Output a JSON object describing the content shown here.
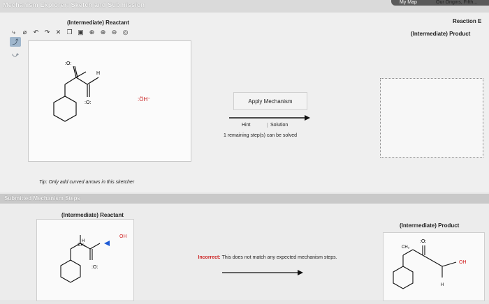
{
  "header": {
    "title": "Mechanism Explorer: Sketch and Submission",
    "nav_my_map": "My Map",
    "nav_origins": "Our Origins, Fifth..."
  },
  "upper": {
    "reactant_label": "(Intermediate) Reactant",
    "reaction_label": "Reaction E",
    "product_label": "(Intermediate) Product",
    "tip": "Tip: Only add curved arrows in this sketcher",
    "apply_button": "Apply Mechanism",
    "hint_button": "Hint",
    "solution_button": "Solution",
    "remaining_steps": "1 remaining step(s) can be solved",
    "hydroxide_label": ":ÖH⁻",
    "aldehyde_h": "H",
    "aldehyde_o": ":O:"
  },
  "submitted": {
    "header": "Submitted Mechanism Steps",
    "reactant_label": "(Intermediate) Reactant",
    "product_label": "(Intermediate) Product",
    "incorrect_label": "Incorrect:",
    "incorrect_message": "This does not match any expected mechanism steps.",
    "reactant_ch3": "CH₃",
    "reactant_h": "H",
    "reactant_oh": "OH",
    "product_ch3": "CH₃",
    "product_oh": "OH",
    "product_h": "H"
  },
  "toolbar": {
    "tools": [
      "select-icon",
      "eraser-icon",
      "undo-icon",
      "redo-icon",
      "clear-icon",
      "copy-icon",
      "paste-icon",
      "zoom-in-icon",
      "zoom-in-alt-icon",
      "zoom-out-icon",
      "zoom-fit-icon"
    ]
  },
  "colors": {
    "incorrect": "#cc2222",
    "arrow": "#111111",
    "lone_pair_red": "#d02020",
    "selection_blue": "#1e5bd6"
  }
}
